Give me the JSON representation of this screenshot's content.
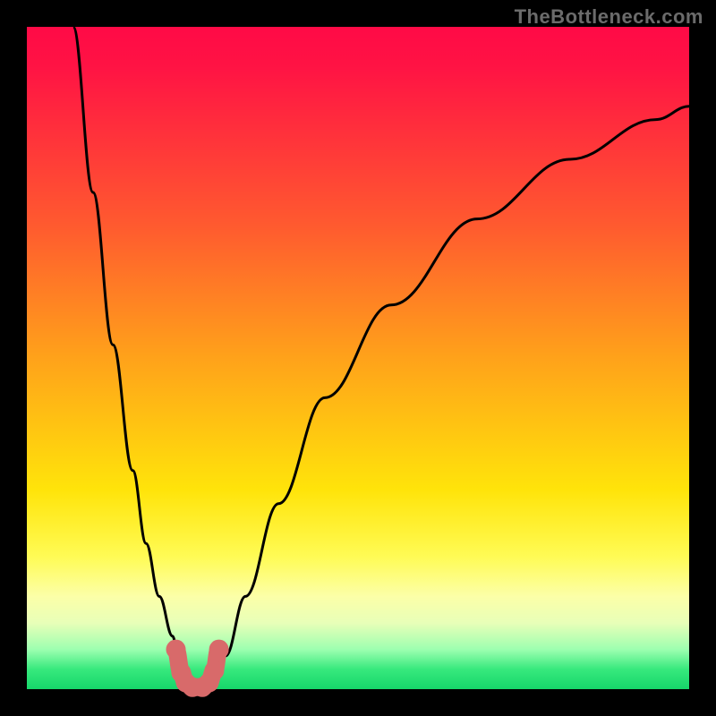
{
  "watermark": "TheBottleneck.com",
  "chart_data": {
    "type": "line",
    "title": "",
    "xlabel": "",
    "ylabel": "",
    "xlim": [
      0,
      100
    ],
    "ylim": [
      0,
      100
    ],
    "grid": false,
    "legend": false,
    "series": [
      {
        "name": "left-curve",
        "x": [
          7,
          10,
          13,
          16,
          18,
          20,
          22,
          23,
          24,
          25
        ],
        "y": [
          100,
          75,
          52,
          33,
          22,
          14,
          8,
          4,
          2,
          0
        ]
      },
      {
        "name": "right-curve",
        "x": [
          28,
          30,
          33,
          38,
          45,
          55,
          68,
          82,
          95,
          100
        ],
        "y": [
          0,
          5,
          14,
          28,
          44,
          58,
          71,
          80,
          86,
          88
        ]
      }
    ],
    "highlight": {
      "name": "optimal-range",
      "color": "#d86a6a",
      "dots_x": [
        22.5,
        23.3,
        24.0,
        25.0,
        26.5,
        27.5,
        28.3,
        29.0
      ],
      "dots_y": [
        6.0,
        2.5,
        1.0,
        0.3,
        0.3,
        1.0,
        2.8,
        6.0
      ]
    },
    "background_gradient": {
      "top": "#ff0a46",
      "mid": "#ffe40a",
      "bottom": "#16d66a"
    }
  }
}
